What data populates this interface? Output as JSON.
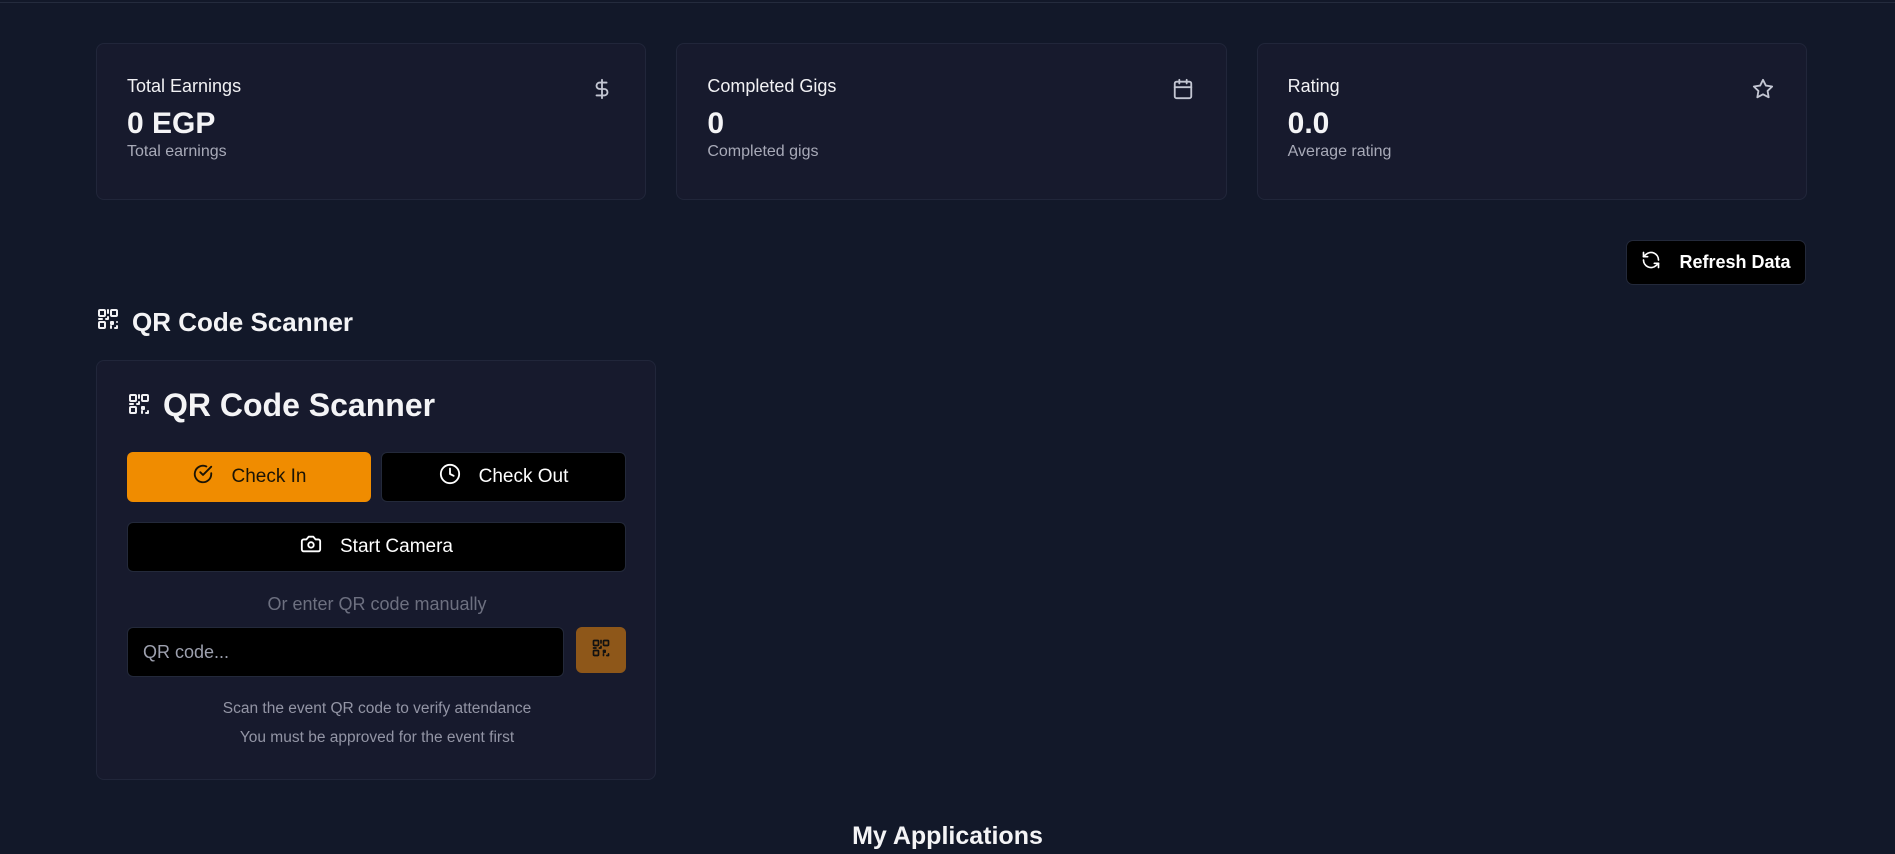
{
  "stats": [
    {
      "title": "Total Earnings",
      "value": "0 EGP",
      "subtitle": "Total earnings",
      "icon": "dollar-icon"
    },
    {
      "title": "Completed Gigs",
      "value": "0",
      "subtitle": "Completed gigs",
      "icon": "calendar-icon"
    },
    {
      "title": "Rating",
      "value": "0.0",
      "subtitle": "Average rating",
      "icon": "star-icon"
    }
  ],
  "toolbar": {
    "refresh_label": "Refresh Data"
  },
  "scanner_section": {
    "title": "QR Code Scanner"
  },
  "scanner": {
    "title": "QR Code Scanner",
    "check_in_label": "Check In",
    "check_out_label": "Check Out",
    "start_camera_label": "Start Camera",
    "manual_label": "Or enter QR code manually",
    "input_placeholder": "QR code...",
    "input_value": "",
    "hint_1": "Scan the event QR code to verify attendance",
    "hint_2": "You must be approved for the event first"
  },
  "applications": {
    "title": "My Applications"
  },
  "colors": {
    "background": "#121829",
    "card": "#171a2d",
    "accent": "#f08c00",
    "accent_muted": "#8e5719"
  }
}
